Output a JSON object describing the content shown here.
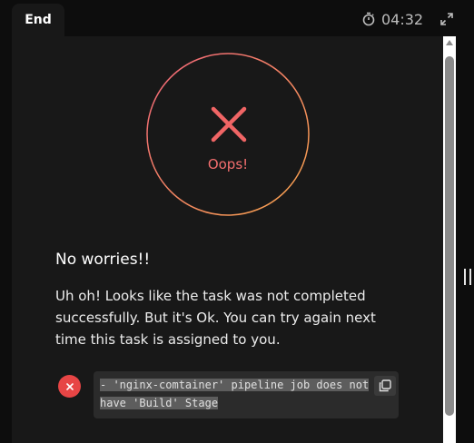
{
  "tab": {
    "label": "End"
  },
  "timer": {
    "value": "04:32",
    "icon": "stopwatch-icon"
  },
  "result": {
    "status_label": "Oops!",
    "icon": "x-mark-icon",
    "heading": "No worries!!",
    "message": "Uh oh! Looks like the task was not completed successfully. But it's Ok. You can try again next time this task is assigned to you."
  },
  "check": {
    "icon": "error-x-icon",
    "log_line1": " - 'nginx-comtainer' pipeline job does not",
    "log_line2": "have 'Build' Stage"
  },
  "colors": {
    "background": "#0d0d0d",
    "panel": "#181818",
    "error": "#e74545",
    "ring_start": "#f0637a",
    "ring_end": "#f7a54c"
  }
}
